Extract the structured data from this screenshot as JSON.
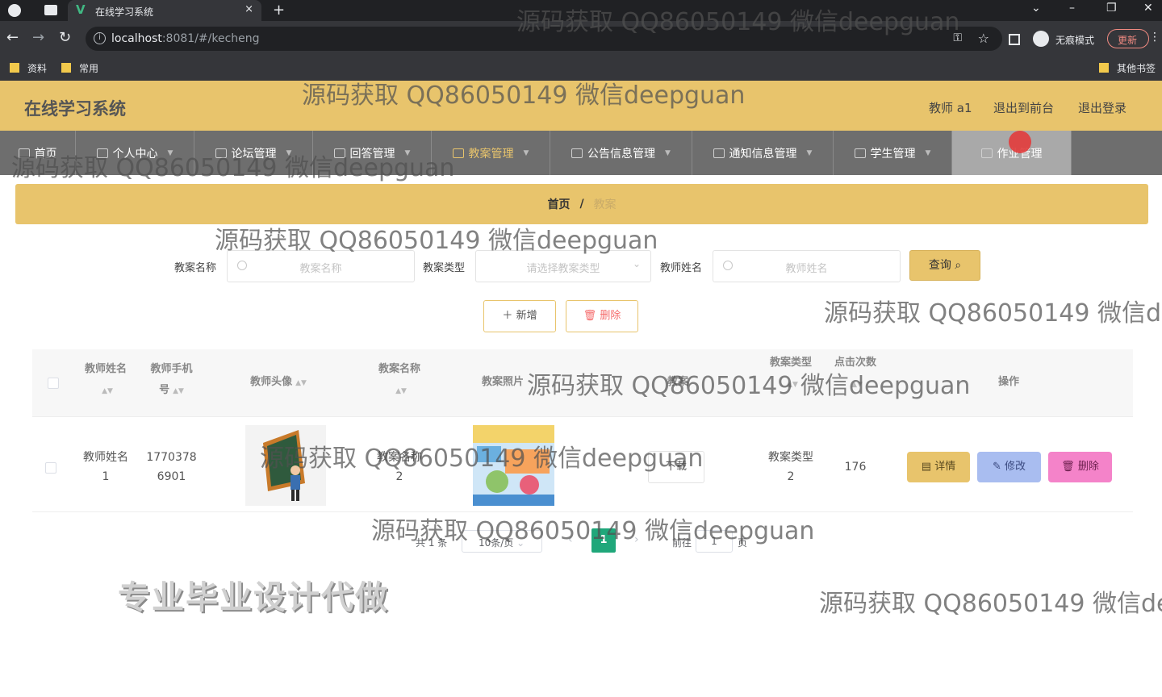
{
  "browser": {
    "tab_title": "在线学习系统",
    "tab_favicon": "V",
    "tab_close": "×",
    "new_tab": "+",
    "url_host": "localhost",
    "url_rest": ":8081/#/kecheng",
    "incognito_label": "无痕模式",
    "update_label": "更新",
    "bookmarks": [
      "资料",
      "常用"
    ],
    "other_bookmarks": "其他书签"
  },
  "header": {
    "brand": "在线学习系统",
    "user": "教师 a1",
    "to_front": "退出到前台",
    "logout": "退出登录",
    "accent_color": "#e8c46c"
  },
  "menu": [
    "首页",
    "个人中心",
    "论坛管理",
    "回答管理",
    "教案管理",
    "公告信息管理",
    "通知信息管理",
    "学生管理",
    "作业管理"
  ],
  "breadcrumb": {
    "home": "首页",
    "sep": "/",
    "current": "教案"
  },
  "search": {
    "name_label": "教案名称",
    "name_placeholder": "教案名称",
    "type_label": "教案类型",
    "type_placeholder": "请选择教案类型",
    "teacher_label": "教师姓名",
    "teacher_placeholder": "教师姓名",
    "query_button": "查询"
  },
  "actions": {
    "add": "新增",
    "delete": "删除"
  },
  "table": {
    "headers": {
      "teacher_name": "教师姓名",
      "teacher_phone_1": "教师手机",
      "teacher_phone_2": "号",
      "avatar": "教师头像",
      "plan_name": "教案名称",
      "plan_photo": "教案照片",
      "plan_file": "教案",
      "plan_type": "教案类型",
      "clicks": "点击次数",
      "ops": "操作"
    },
    "rows": [
      {
        "teacher_name_1": "教师姓名",
        "teacher_name_2": "1",
        "phone_1": "1770378",
        "phone_2": "6901",
        "plan_name_1": "教案名称",
        "plan_name_2": "2",
        "download": "下载",
        "type_1": "教案类型",
        "type_2": "2",
        "clicks": "176",
        "detail": "详情",
        "edit": "修改",
        "delete": "删除"
      }
    ]
  },
  "pagination": {
    "total": "共 1 条",
    "page_size": "10条/页",
    "current_page": "1",
    "goto_label": "前往",
    "goto_value": "1",
    "page_unit": "页"
  },
  "overlay": {
    "stamp": "专业毕业设计代做",
    "watermark": "源码获取 QQ86050149 微信deepguan",
    "watermark_cut": "源码获取 QQ86050149 微信de"
  }
}
